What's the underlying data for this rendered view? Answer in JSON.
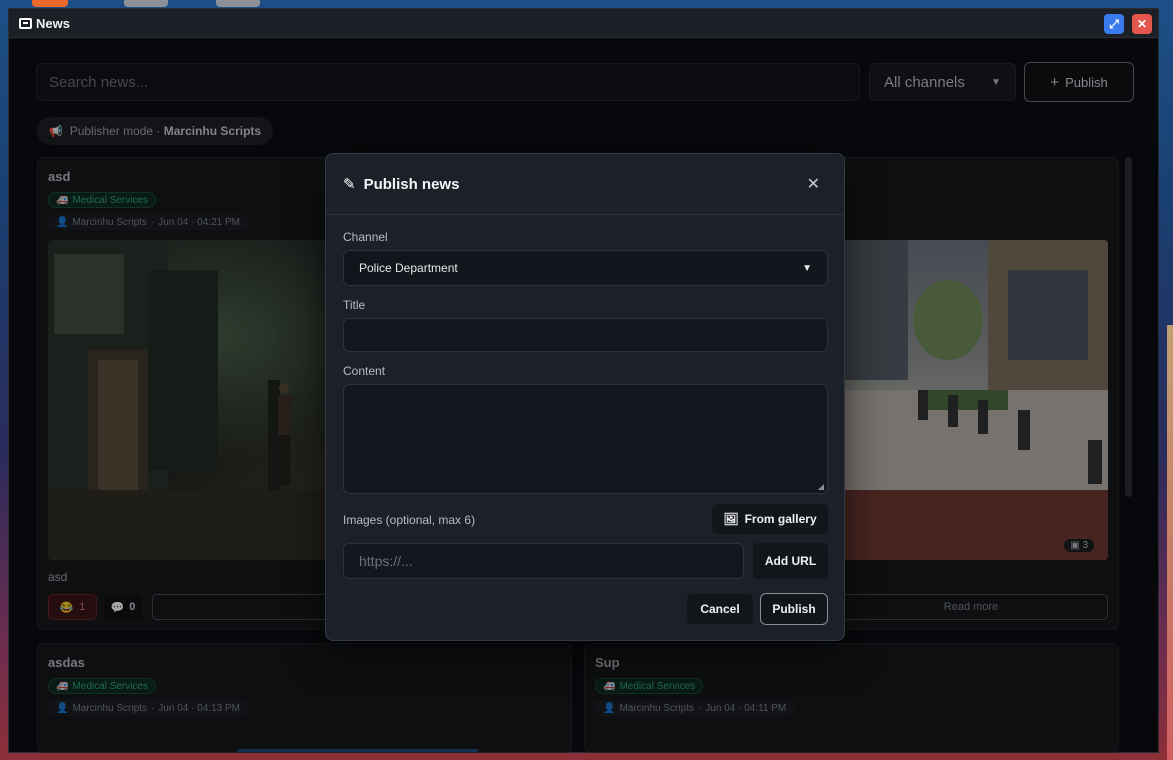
{
  "window": {
    "title": "News"
  },
  "toolbar": {
    "search_placeholder": "Search news...",
    "channel_selected": "All channels",
    "publish_label": "Publish"
  },
  "publisher_mode": {
    "prefix": "Publisher mode · ",
    "name": "Marcinhu Scripts"
  },
  "cards": [
    {
      "title": "asd",
      "tag": "Medical Services",
      "author": "Marcinhu Scripts",
      "date": "Jun 04 · 04:21 PM",
      "description": "asd",
      "reactions": "1",
      "comments": "0",
      "image_count": "3",
      "read_more": "Read more"
    },
    {
      "title": "asdas",
      "tag": "Medical Services",
      "author": "Marcinhu Scripts",
      "date": "Jun 04 · 04:13 PM"
    },
    {
      "title": "Sup",
      "tag": "Medical Services",
      "author": "Marcinhu Scripts",
      "date": "Jun 04 · 04:11 PM"
    }
  ],
  "modal": {
    "title": "Publish news",
    "channel_label": "Channel",
    "channel_selected": "Police Department",
    "title_label": "Title",
    "title_value": "",
    "content_label": "Content",
    "content_value": "",
    "images_label": "Images (optional, max 6)",
    "gallery_label": "From gallery",
    "url_placeholder": "https://...",
    "add_url_label": "Add URL",
    "cancel_label": "Cancel",
    "publish_label": "Publish"
  },
  "colors": {
    "accent_green": "#2fa57b",
    "close_red": "#e4574c",
    "expand_blue": "#3a7cf0"
  }
}
